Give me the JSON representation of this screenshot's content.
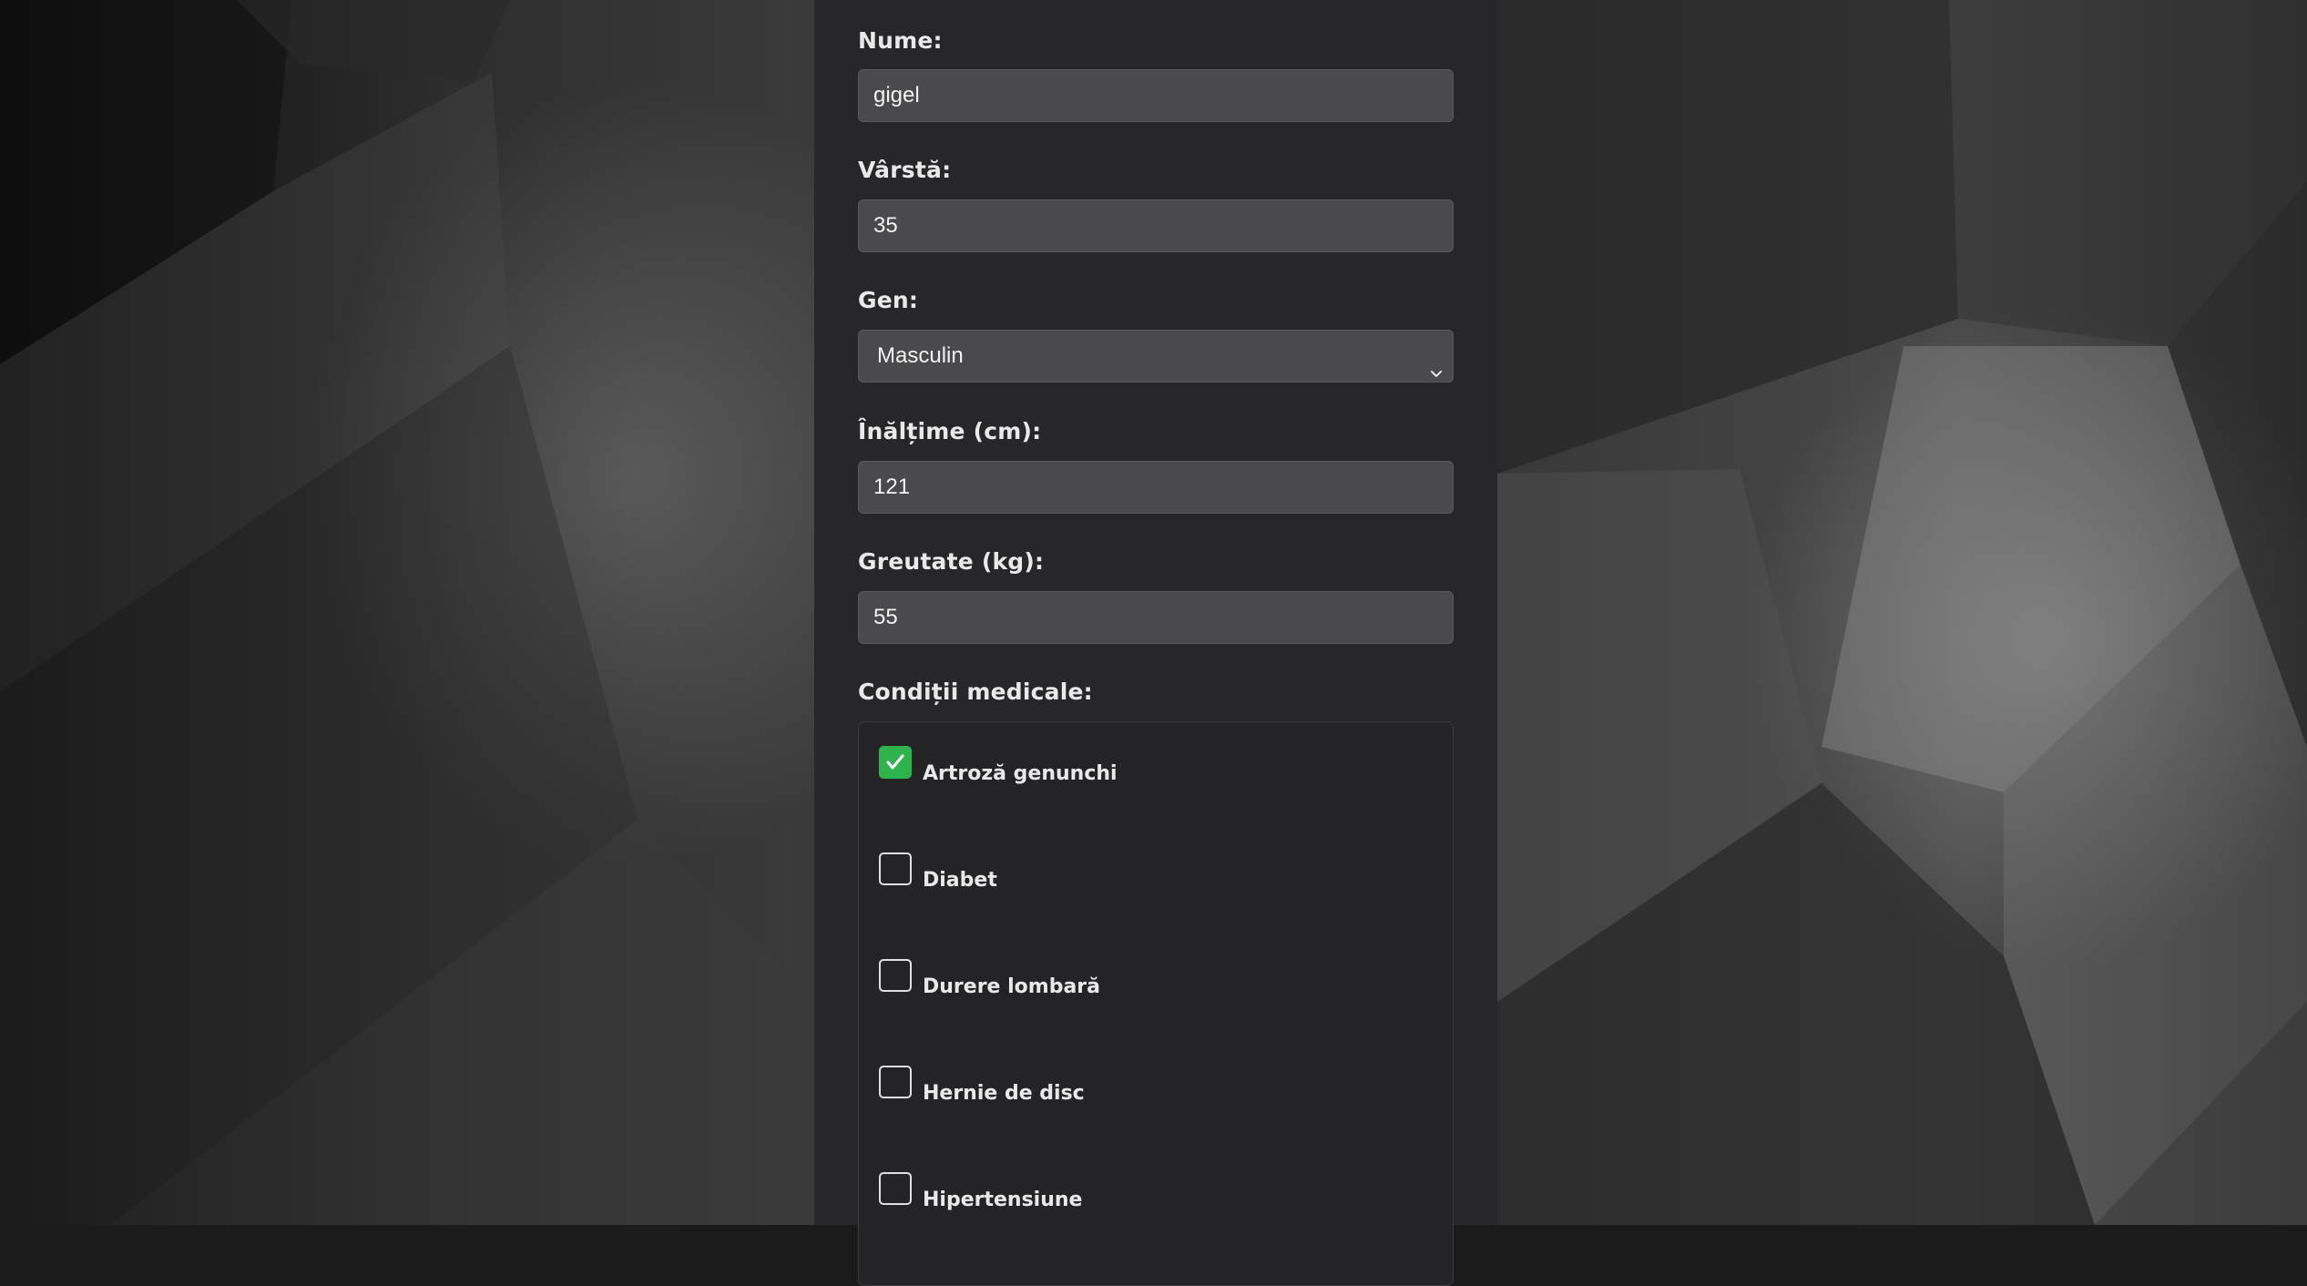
{
  "form": {
    "name": {
      "label": "Nume:",
      "value": "gigel"
    },
    "age": {
      "label": "Vârstă:",
      "value": "35"
    },
    "gender": {
      "label": "Gen:",
      "selected": "Masculin"
    },
    "height": {
      "label": "Înălțime (cm):",
      "value": "121"
    },
    "weight": {
      "label": "Greutate (kg):",
      "value": "55"
    },
    "conditions": {
      "label": "Condiții medicale:",
      "items": [
        {
          "label": "Artroză genunchi",
          "checked": true
        },
        {
          "label": "Diabet",
          "checked": false
        },
        {
          "label": "Durere lombară",
          "checked": false
        },
        {
          "label": "Hernie de disc",
          "checked": false
        },
        {
          "label": "Hipertensiune",
          "checked": false
        }
      ]
    }
  },
  "colors": {
    "panel": "#27272a",
    "input": "#4a4a4c",
    "checked": "#2fb34c",
    "text": "#e9e9ea"
  },
  "icons": {
    "select": "chevron-down-icon",
    "checkmark": "checkmark-icon"
  }
}
